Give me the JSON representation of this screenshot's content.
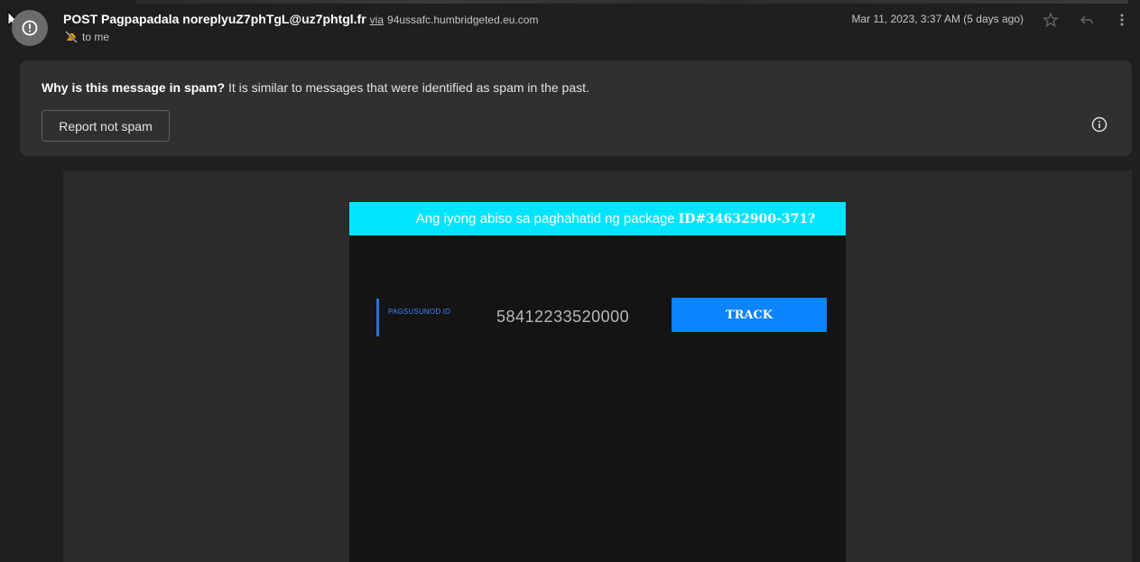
{
  "header": {
    "sender_name": "POST Pagpapadala noreplyuZ7phTgL@uz7phtgl.fr",
    "via_label": "via",
    "via_domain": "94ussafc.humbridgeted.eu.com",
    "recipient": "to me",
    "date": "Mar 11, 2023, 3:37 AM (5 days ago)",
    "icons": {
      "avatar": "warning-circle-icon",
      "label": "important-tag-icon",
      "star": "star-icon",
      "reply": "reply-icon",
      "more": "more-vert-icon"
    }
  },
  "spam_notice": {
    "question": "Why is this message in spam?",
    "explanation": " It is similar to messages that were identified as spam in the past.",
    "button_label": "Report not spam",
    "info_icon": "info-icon"
  },
  "email_content": {
    "banner_text": "Ang iyong abiso sa paghahatid ng package ",
    "banner_id": "ID#34632900-371?",
    "tracking_label": "PAGSUSUNOD ID",
    "tracking_number": "58412233520000",
    "track_button": "TRACK"
  },
  "colors": {
    "background": "#1f1f1f",
    "spam_box": "#303030",
    "banner": "#00e5ff",
    "track_button": "#0a84ff",
    "tracking_label": "#3f82ff"
  }
}
